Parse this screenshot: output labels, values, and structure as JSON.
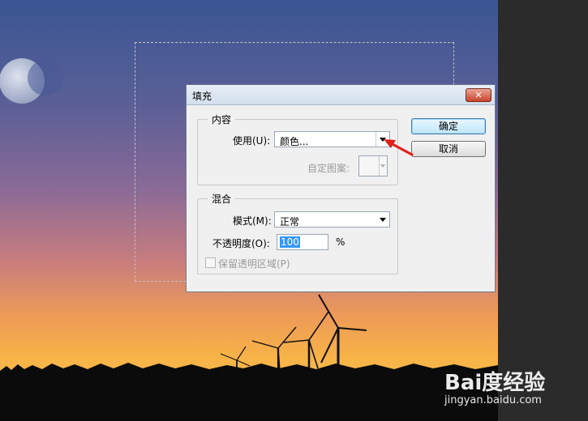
{
  "dialog": {
    "title": "填充",
    "close_label": "✕",
    "content_group": {
      "legend": "内容",
      "use_label": "使用(U):",
      "use_value": "颜色...",
      "custom_pattern_label": "自定图案:"
    },
    "blend_group": {
      "legend": "混合",
      "mode_label": "模式(M):",
      "mode_value": "正常",
      "opacity_label": "不透明度(O):",
      "opacity_value": "100",
      "opacity_unit": "%",
      "preserve_label": "保留透明区域(P)"
    },
    "ok_label": "确定",
    "cancel_label": "取消"
  },
  "watermark": {
    "logo": "Bai度经验",
    "url": "jingyan.baidu.com"
  },
  "colors": {
    "annotation_arrow": "#e0201b",
    "sky_top": "#3a5694",
    "sunset": "#f2a23a"
  }
}
